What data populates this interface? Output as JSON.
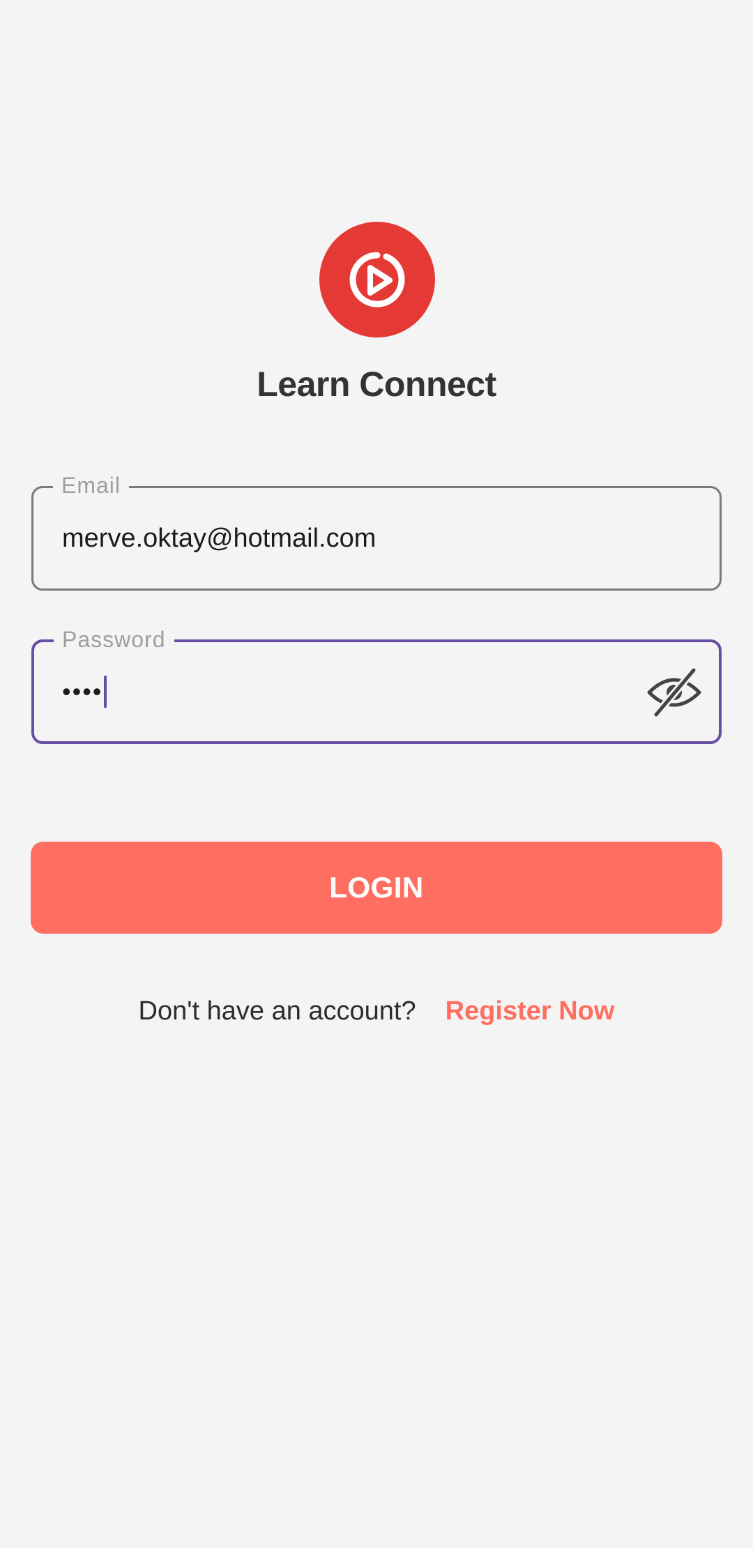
{
  "app": {
    "title": "Learn Connect",
    "logo_icon": "play-circle-icon",
    "brand_color": "#e53935"
  },
  "form": {
    "email": {
      "label": "Email",
      "value": "merve.oktay@hotmail.com"
    },
    "password": {
      "label": "Password",
      "value": "••••",
      "toggle_icon": "eye-off-icon",
      "focused": true
    }
  },
  "actions": {
    "login_label": "LOGIN",
    "login_color": "#ff6f61"
  },
  "register": {
    "prompt": "Don't have an account?",
    "link": "Register Now"
  },
  "colors": {
    "focus": "#6750a4",
    "background": "#f4f4f5"
  }
}
